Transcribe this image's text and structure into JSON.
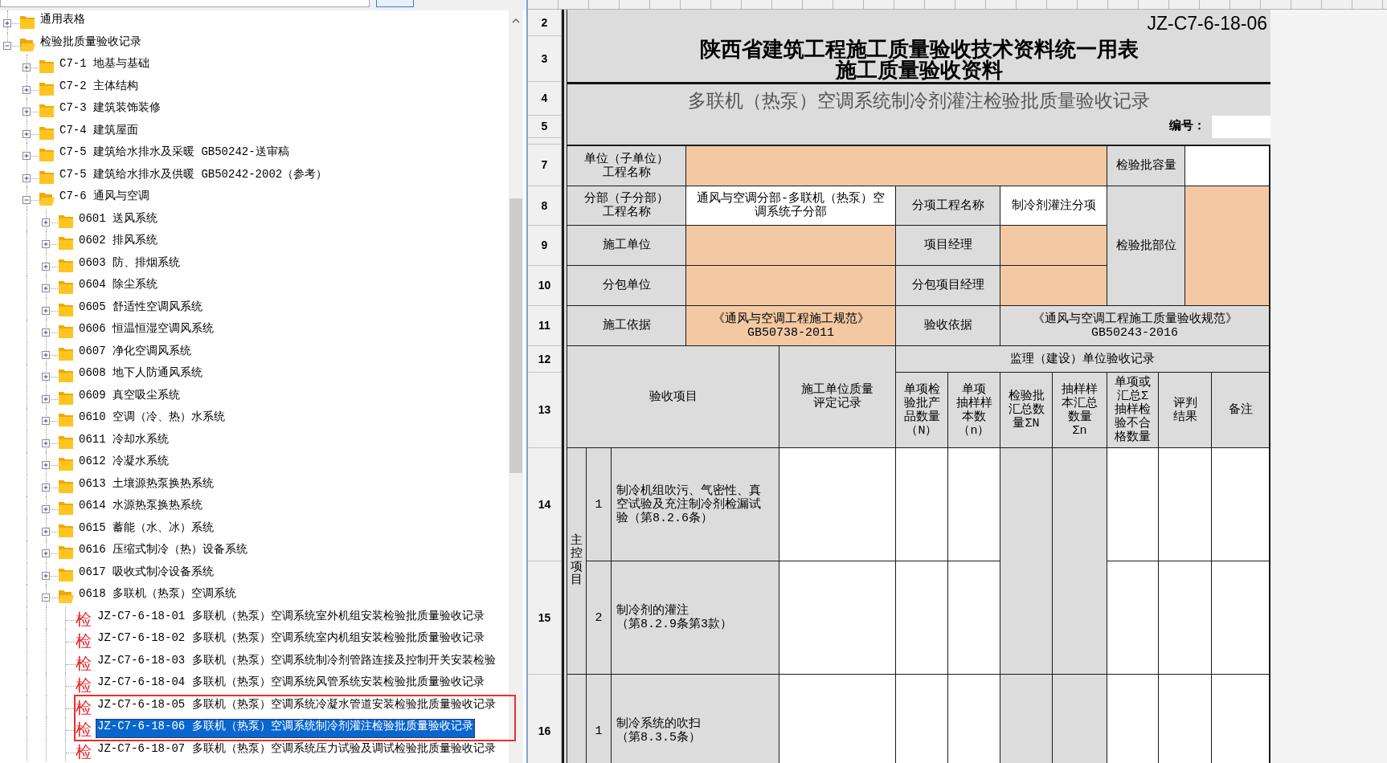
{
  "tree": [
    {
      "kind": "folder",
      "label": "通用表格",
      "expanded": false,
      "selected": false
    },
    {
      "kind": "folder",
      "label": "检验批质量验收记录",
      "expanded": true,
      "selected": false,
      "children": [
        {
          "kind": "folder",
          "label": "C7-1 地基与基础",
          "expanded": false,
          "selected": false
        },
        {
          "kind": "folder",
          "label": "C7-2 主体结构",
          "expanded": false,
          "selected": false
        },
        {
          "kind": "folder",
          "label": "C7-3 建筑装饰装修",
          "expanded": false,
          "selected": false
        },
        {
          "kind": "folder",
          "label": "C7-4 建筑屋面",
          "expanded": false,
          "selected": false
        },
        {
          "kind": "folder",
          "label": "C7-5 建筑给水排水及采暖 GB50242-送审稿",
          "expanded": false,
          "selected": false
        },
        {
          "kind": "folder",
          "label": "C7-5 建筑给水排水及供暖 GB50242-2002（参考）",
          "expanded": false,
          "selected": false
        },
        {
          "kind": "folder",
          "label": "C7-6 通风与空调",
          "expanded": true,
          "selected": false,
          "children": [
            {
              "kind": "folder",
              "label": "0601 送风系统",
              "expanded": false,
              "selected": false
            },
            {
              "kind": "folder",
              "label": "0602 排风系统",
              "expanded": false,
              "selected": false
            },
            {
              "kind": "folder",
              "label": "0603 防、排烟系统",
              "expanded": false,
              "selected": false
            },
            {
              "kind": "folder",
              "label": "0604 除尘系统",
              "expanded": false,
              "selected": false
            },
            {
              "kind": "folder",
              "label": "0605 舒适性空调风系统",
              "expanded": false,
              "selected": false
            },
            {
              "kind": "folder",
              "label": "0606 恒温恒湿空调风系统",
              "expanded": false,
              "selected": false
            },
            {
              "kind": "folder",
              "label": "0607 净化空调风系统",
              "expanded": false,
              "selected": false
            },
            {
              "kind": "folder",
              "label": "0608 地下人防通风系统",
              "expanded": false,
              "selected": false
            },
            {
              "kind": "folder",
              "label": "0609 真空吸尘系统",
              "expanded": false,
              "selected": false
            },
            {
              "kind": "folder",
              "label": "0610 空调（冷、热）水系统",
              "expanded": false,
              "selected": false
            },
            {
              "kind": "folder",
              "label": "0611 冷却水系统",
              "expanded": false,
              "selected": false
            },
            {
              "kind": "folder",
              "label": "0612 冷凝水系统",
              "expanded": false,
              "selected": false
            },
            {
              "kind": "folder",
              "label": "0613 土壤源热泵换热系统",
              "expanded": false,
              "selected": false
            },
            {
              "kind": "folder",
              "label": "0614 水源热泵换热系统",
              "expanded": false,
              "selected": false
            },
            {
              "kind": "folder",
              "label": "0615 蓄能（水、冰）系统",
              "expanded": false,
              "selected": false
            },
            {
              "kind": "folder",
              "label": "0616 压缩式制冷（热）设备系统",
              "expanded": false,
              "selected": false
            },
            {
              "kind": "folder",
              "label": "0617 吸收式制冷设备系统",
              "expanded": false,
              "selected": false
            },
            {
              "kind": "folder",
              "label": "0618 多联机（热泵）空调系统",
              "expanded": true,
              "selected": false,
              "children": [
                {
                  "kind": "record",
                  "badge": "检",
                  "label": "JZ-C7-6-18-01 多联机（热泵）空调系统室外机组安装检验批质量验收记录",
                  "selected": false,
                  "annotated": false
                },
                {
                  "kind": "record",
                  "badge": "检",
                  "label": "JZ-C7-6-18-02 多联机（热泵）空调系统室内机组安装检验批质量验收记录",
                  "selected": false,
                  "annotated": false
                },
                {
                  "kind": "record",
                  "badge": "检",
                  "label": "JZ-C7-6-18-03 多联机（热泵）空调系统制冷剂管路连接及控制开关安装检验",
                  "selected": false,
                  "annotated": false
                },
                {
                  "kind": "record",
                  "badge": "检",
                  "label": "JZ-C7-6-18-04 多联机（热泵）空调系统风管系统安装检验批质量验收记录",
                  "selected": false,
                  "annotated": false
                },
                {
                  "kind": "record",
                  "badge": "检",
                  "label": "JZ-C7-6-18-05 多联机（热泵）空调系统冷凝水管道安装检验批质量验收记录",
                  "selected": false,
                  "annotated": true
                },
                {
                  "kind": "record",
                  "badge": "检",
                  "label": "JZ-C7-6-18-06 多联机（热泵）空调系统制冷剂灌注检验批质量验收记录",
                  "selected": true,
                  "annotated": true
                },
                {
                  "kind": "record",
                  "badge": "检",
                  "label": "JZ-C7-6-18-07 多联机（热泵）空调系统压力试验及调试检验批质量验收记录",
                  "selected": false,
                  "annotated": false
                }
              ]
            }
          ]
        }
      ]
    }
  ],
  "sheet": {
    "row_numbers": [
      "2",
      "3",
      "4",
      "5",
      "7",
      "8",
      "9",
      "10",
      "11",
      "12",
      "13",
      "14",
      "15",
      "16"
    ],
    "code": "JZ-C7-6-18-06",
    "title_lines": [
      "陕西省建筑工程施工质量验收技术资料统一用表",
      "施工质量验收资料"
    ],
    "subtitle": "多联机（热泵）空调系统制冷剂灌注检验批质量验收记录",
    "number_label": "编号：",
    "info_rows": [
      [
        {
          "kind": "label",
          "lines": [
            "单位（子单位）",
            "工程名称"
          ]
        },
        {
          "kind": "input"
        },
        {
          "kind": "label",
          "lines": [
            "检验批容量"
          ]
        },
        {
          "kind": "value"
        }
      ],
      [
        {
          "kind": "label",
          "lines": [
            "分部（子分部）",
            "工程名称"
          ]
        },
        {
          "kind": "value",
          "lines": [
            "通风与空调分部-多联机（热泵）空",
            "调系统子分部"
          ]
        },
        {
          "kind": "label",
          "lines": [
            "分项工程名称"
          ]
        },
        {
          "kind": "value",
          "lines": [
            "制冷剂灌注分项"
          ]
        },
        {
          "kind": "label",
          "lines": [
            "检验批部位"
          ]
        },
        {
          "kind": "input"
        }
      ],
      [
        {
          "kind": "label",
          "lines": [
            "施工单位"
          ]
        },
        {
          "kind": "input"
        },
        {
          "kind": "label",
          "lines": [
            "项目经理"
          ]
        },
        {
          "kind": "input"
        }
      ],
      [
        {
          "kind": "label",
          "lines": [
            "分包单位"
          ]
        },
        {
          "kind": "input"
        },
        {
          "kind": "label",
          "lines": [
            "分包项目经理"
          ]
        },
        {
          "kind": "input"
        }
      ],
      [
        {
          "kind": "label",
          "lines": [
            "施工依据"
          ]
        },
        {
          "kind": "input",
          "lines": [
            "《通风与空调工程施工规范》",
            "GB50738-2011"
          ]
        },
        {
          "kind": "label",
          "lines": [
            "验收依据"
          ]
        },
        {
          "kind": "fixed",
          "lines": [
            "《通风与空调工程施工质量验收规范》",
            "GB50243-2016"
          ]
        }
      ]
    ],
    "check_header": {
      "item": "验收项目",
      "contractor_lines": [
        "施工单位质量",
        "评定记录"
      ],
      "supervision": "监理（建设）单位验收记录",
      "columns": [
        [
          "单项检",
          "验批产",
          "品数量",
          "（N）"
        ],
        [
          "单项",
          "抽样样",
          "本数",
          "（n）"
        ],
        [
          "检验批",
          "汇总数",
          "量ΣN"
        ],
        [
          "抽样样",
          "本汇总",
          "数量",
          "Σn"
        ],
        [
          "单项或",
          "汇总Σ",
          "抽样检",
          "验不合",
          "格数量"
        ],
        [
          "评判",
          "结果"
        ],
        [
          "备注"
        ]
      ]
    },
    "sections": [
      {
        "label": "主控项目",
        "items": [
          {
            "number": "1",
            "lines": [
              "制冷机组吹污、气密性、真",
              "空试验及充注制冷剂检漏试",
              "验（第8.2.6条）"
            ]
          },
          {
            "number": "2",
            "lines": [
              "制冷剂的灌注",
              "（第8.2.9条第3款）"
            ]
          }
        ]
      },
      {
        "items": [
          {
            "number": "1",
            "lines": [
              "制冷系统的吹扫",
              "（第8.3.5条）"
            ]
          }
        ]
      }
    ]
  }
}
